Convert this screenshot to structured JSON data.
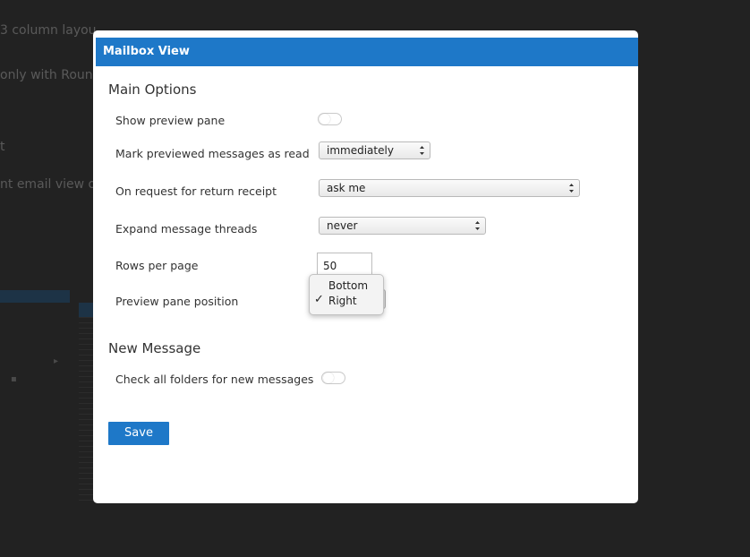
{
  "background": {
    "fragments": [
      "3 column layou",
      "only with Roun",
      "t",
      "nt email view or"
    ]
  },
  "dialog": {
    "title": "Mailbox View",
    "main_section": "Main Options",
    "fields": {
      "show_preview": {
        "label": "Show preview pane",
        "value": false
      },
      "mark_read": {
        "label": "Mark previewed messages as read",
        "value": "immediately"
      },
      "return_receipt": {
        "label": "On request for return receipt",
        "value": "ask me"
      },
      "expand_threads": {
        "label": "Expand message threads",
        "value": "never"
      },
      "rows_per_page": {
        "label": "Rows per page",
        "value": "50"
      },
      "preview_position": {
        "label": "Preview pane position",
        "options": [
          "Bottom",
          "Right"
        ],
        "selected": "Right"
      }
    },
    "new_section": "New Message",
    "check_all": {
      "label": "Check all folders for new messages",
      "value": false
    },
    "save_label": "Save"
  },
  "colors": {
    "accent": "#1e78c8",
    "overlay": "#222222"
  },
  "icons": {
    "check": "checkmark-icon",
    "select_arrows": "select-arrows-icon"
  }
}
